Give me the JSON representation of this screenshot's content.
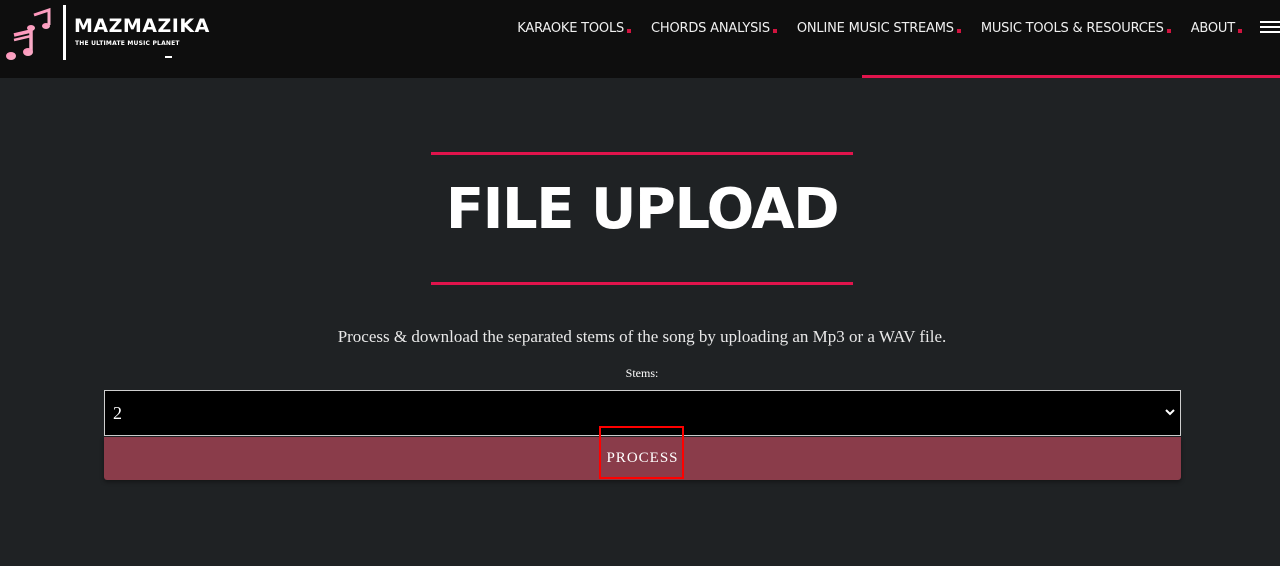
{
  "brand": {
    "name": "MAZMAZIKA",
    "tagline": "THE ULTIMATE MUSIC PLANET",
    "logo_icon": "music-notes-icon"
  },
  "nav": {
    "items": [
      {
        "label": "KARAOKE TOOLS"
      },
      {
        "label": "CHORDS ANALYSIS"
      },
      {
        "label": "ONLINE MUSIC STREAMS"
      },
      {
        "label": "MUSIC TOOLS & RESOURCES"
      },
      {
        "label": "ABOUT"
      }
    ],
    "menu_icon": "hamburger-menu-icon"
  },
  "main": {
    "title": "FILE UPLOAD",
    "description": "Process & download the separated stems of the song by uploading an Mp3 or a WAV file.",
    "stems_label": "Stems:",
    "stems_value": "2",
    "process_label": "PROCESS"
  },
  "colors": {
    "accent": "#e0144c",
    "button": "#8a3c4a",
    "header_bg": "#0e0e0e",
    "page_bg": "#1f2224"
  }
}
